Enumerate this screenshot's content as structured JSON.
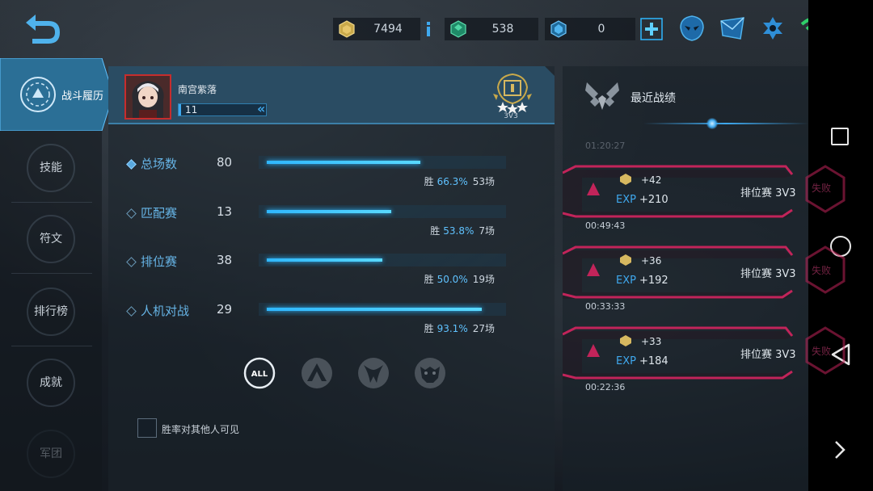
{
  "topbar": {
    "resources": [
      {
        "icon": "gold-coin-icon",
        "value": "7494"
      },
      {
        "icon": "green-gem-icon",
        "value": "538"
      },
      {
        "icon": "blue-crystal-icon",
        "value": "0"
      }
    ],
    "icons": [
      "info-icon",
      "add-icon",
      "mask-icon",
      "mail-icon",
      "settings-icon",
      "wifi-icon",
      "battery-icon"
    ]
  },
  "sidebar": {
    "items": [
      {
        "label": "战斗履历",
        "active": true
      },
      {
        "label": "技能"
      },
      {
        "label": "符文"
      },
      {
        "label": "排行榜"
      },
      {
        "label": "成就"
      },
      {
        "label": "军团"
      }
    ]
  },
  "profile": {
    "name": "南宫紫落",
    "level": "11",
    "rank_label": "3V3"
  },
  "stats": [
    {
      "name": "总场数",
      "count": "80",
      "win_label": "胜",
      "win_pct": "66.3%",
      "games": "53场",
      "fill": 0.663,
      "highlight": true
    },
    {
      "name": "匹配赛",
      "count": "13",
      "win_label": "胜",
      "win_pct": "53.8%",
      "games": "7场",
      "fill": 0.538
    },
    {
      "name": "排位赛",
      "count": "38",
      "win_label": "胜",
      "win_pct": "50.0%",
      "games": "19场",
      "fill": 0.5
    },
    {
      "name": "人机对战",
      "count": "29",
      "win_label": "胜",
      "win_pct": "93.1%",
      "games": "27场",
      "fill": 0.931
    }
  ],
  "filters": {
    "all_label": "ALL"
  },
  "visibility": {
    "label": "胜率对其他人可见"
  },
  "recent": {
    "title": "最近战绩",
    "faded_time": "01:20:27",
    "matches": [
      {
        "gold": "+42",
        "exp_label": "EXP",
        "exp": "+210",
        "mode": "排位赛 3V3",
        "time": "00:49:43",
        "result": "失败"
      },
      {
        "gold": "+36",
        "exp_label": "EXP",
        "exp": "+192",
        "mode": "排位赛 3V3",
        "time": "00:33:33",
        "result": "失败"
      },
      {
        "gold": "+33",
        "exp_label": "EXP",
        "exp": "+184",
        "mode": "排位赛 3V3",
        "time": "00:22:36",
        "result": "失败"
      }
    ]
  },
  "colors": {
    "accent": "#3fa9ef",
    "defeat": "#c23a63",
    "bar": "#2fb7ff"
  }
}
